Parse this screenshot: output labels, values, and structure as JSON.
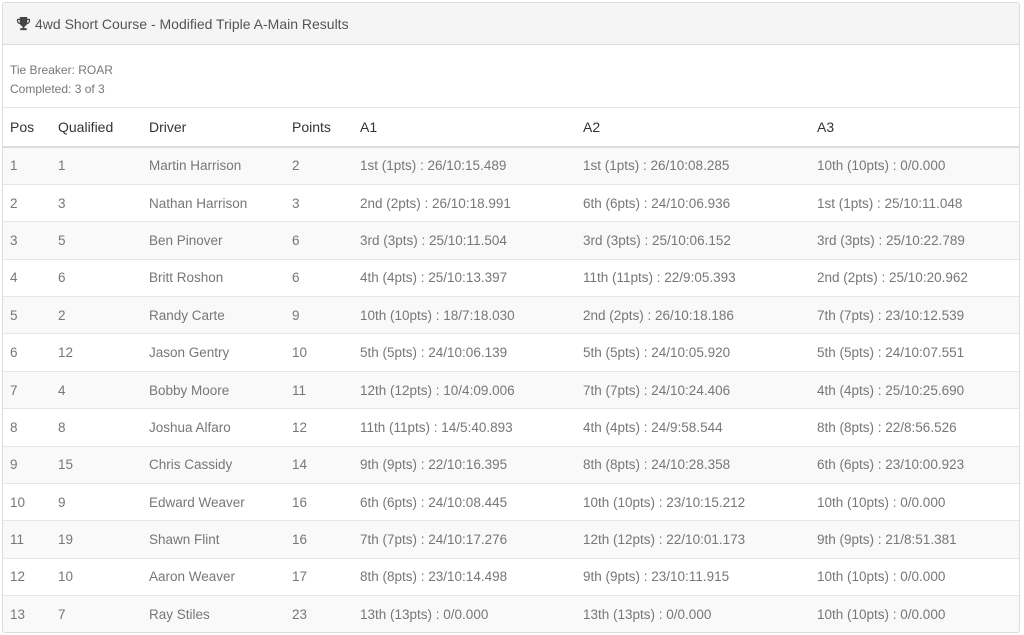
{
  "panel": {
    "title": "4wd Short Course - Modified Triple A-Main Results",
    "icon": "trophy-icon"
  },
  "info": {
    "tie_breaker": "Tie Breaker: ROAR",
    "completed": "Completed: 3 of 3"
  },
  "table": {
    "columns": [
      "Pos",
      "Qualified",
      "Driver",
      "Points",
      "A1",
      "A2",
      "A3"
    ],
    "rows": [
      [
        "1",
        "1",
        "Martin Harrison",
        "2",
        "1st (1pts) : 26/10:15.489",
        "1st (1pts) : 26/10:08.285",
        "10th (10pts) : 0/0.000"
      ],
      [
        "2",
        "3",
        "Nathan Harrison",
        "3",
        "2nd (2pts) : 26/10:18.991",
        "6th (6pts) : 24/10:06.936",
        "1st (1pts) : 25/10:11.048"
      ],
      [
        "3",
        "5",
        "Ben Pinover",
        "6",
        "3rd (3pts) : 25/10:11.504",
        "3rd (3pts) : 25/10:06.152",
        "3rd (3pts) : 25/10:22.789"
      ],
      [
        "4",
        "6",
        "Britt Roshon",
        "6",
        "4th (4pts) : 25/10:13.397",
        "11th (11pts) : 22/9:05.393",
        "2nd (2pts) : 25/10:20.962"
      ],
      [
        "5",
        "2",
        "Randy Carte",
        "9",
        "10th (10pts) : 18/7:18.030",
        "2nd (2pts) : 26/10:18.186",
        "7th (7pts) : 23/10:12.539"
      ],
      [
        "6",
        "12",
        "Jason Gentry",
        "10",
        "5th (5pts) : 24/10:06.139",
        "5th (5pts) : 24/10:05.920",
        "5th (5pts) : 24/10:07.551"
      ],
      [
        "7",
        "4",
        "Bobby Moore",
        "11",
        "12th (12pts) : 10/4:09.006",
        "7th (7pts) : 24/10:24.406",
        "4th (4pts) : 25/10:25.690"
      ],
      [
        "8",
        "8",
        "Joshua Alfaro",
        "12",
        "11th (11pts) : 14/5:40.893",
        "4th (4pts) : 24/9:58.544",
        "8th (8pts) : 22/8:56.526"
      ],
      [
        "9",
        "15",
        "Chris Cassidy",
        "14",
        "9th (9pts) : 22/10:16.395",
        "8th (8pts) : 24/10:28.358",
        "6th (6pts) : 23/10:00.923"
      ],
      [
        "10",
        "9",
        "Edward Weaver",
        "16",
        "6th (6pts) : 24/10:08.445",
        "10th (10pts) : 23/10:15.212",
        "10th (10pts) : 0/0.000"
      ],
      [
        "11",
        "19",
        "Shawn Flint",
        "16",
        "7th (7pts) : 24/10:17.276",
        "12th (12pts) : 22/10:01.173",
        "9th (9pts) : 21/8:51.381"
      ],
      [
        "12",
        "10",
        "Aaron Weaver",
        "17",
        "8th (8pts) : 23/10:14.498",
        "9th (9pts) : 23/10:11.915",
        "10th (10pts) : 0/0.000"
      ],
      [
        "13",
        "7",
        "Ray Stiles",
        "23",
        "13th (13pts) : 0/0.000",
        "13th (13pts) : 0/0.000",
        "10th (10pts) : 0/0.000"
      ]
    ]
  }
}
